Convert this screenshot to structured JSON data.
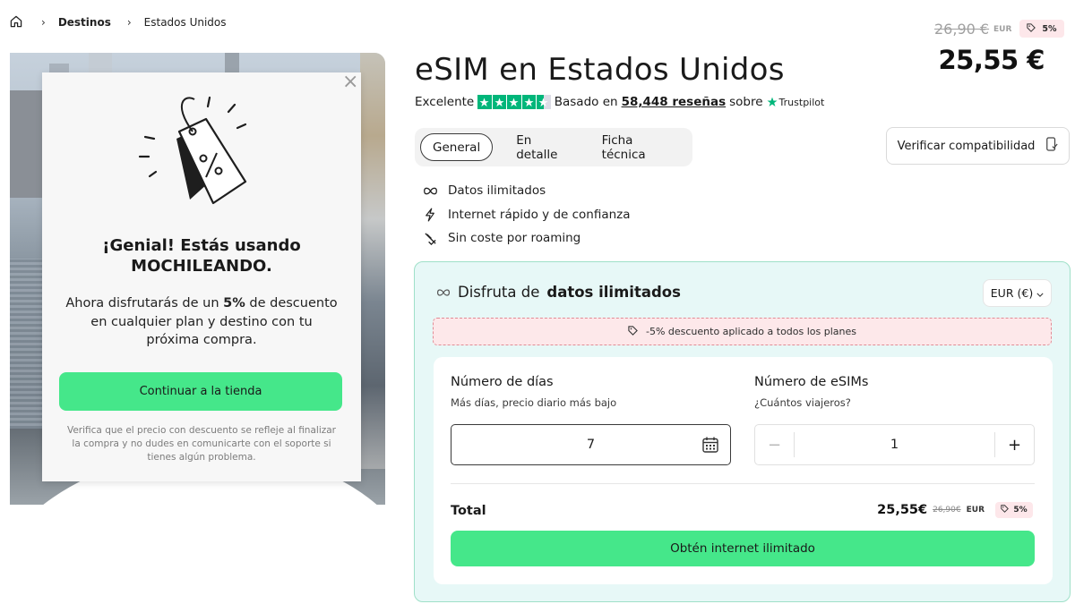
{
  "breadcrumb": {
    "home_icon": "home-icon",
    "items": [
      "Destinos",
      "Estados Unidos"
    ]
  },
  "popup": {
    "close": "×",
    "title_line1": "¡Genial! Estás usando",
    "title_line2": "MOCHILEANDO.",
    "body_before": "Ahora disfrutarás de un ",
    "body_bold": "5%",
    "body_after": " de descuento en cualquier plan y destino con tu próxima compra.",
    "cta": "Continuar a la tienda",
    "note": "Verifica que el precio con descuento se refleje al finalizar la compra y no dudes en comunicarte con el soporte si tienes algún problema."
  },
  "price": {
    "old": "26,90 €",
    "old_currency": "EUR",
    "discount": "5%",
    "current": "25,55 €"
  },
  "product": {
    "title": "eSIM en Estados Unidos",
    "rating_label": "Excelente",
    "rating_stars": 4.5,
    "based_on": "Basado en",
    "reviews": "58,448 reseñas",
    "on": "sobre",
    "trustpilot": "Trustpilot"
  },
  "tabs": [
    {
      "label": "General",
      "active": true
    },
    {
      "label": "En detalle",
      "active": false
    },
    {
      "label": "Ficha técnica",
      "active": false
    }
  ],
  "verify_button": "Verificar compatibilidad",
  "features": [
    {
      "icon": "infinity-icon",
      "label": "Datos ilimitados"
    },
    {
      "icon": "bolt-icon",
      "label": "Internet rápido y de confianza"
    },
    {
      "icon": "no-roaming-icon",
      "label": "Sin coste por roaming"
    }
  ],
  "plan": {
    "heading_prefix": "Disfruta de",
    "heading_bold": "datos ilimitados",
    "currency": "EUR (€)",
    "promo": "-5% descuento aplicado a todos los planes",
    "days_title": "Número de días",
    "days_sub": "Más días, precio diario más bajo",
    "days_value": "7",
    "esims_title": "Número de eSIMs",
    "esims_sub": "¿Cuántos viajeros?",
    "esims_value": "1",
    "minus": "−",
    "plus": "+",
    "total_label": "Total",
    "total_price": "25,55€",
    "total_old": "26,90€",
    "total_currency": "EUR",
    "total_discount": "5%",
    "buy": "Obtén internet ilimitado"
  },
  "colors": {
    "accent_green": "#45e78a",
    "trustpilot_green": "#00b67a",
    "panel_bg": "#e7f8f7",
    "discount_bg": "#fde7ea"
  }
}
